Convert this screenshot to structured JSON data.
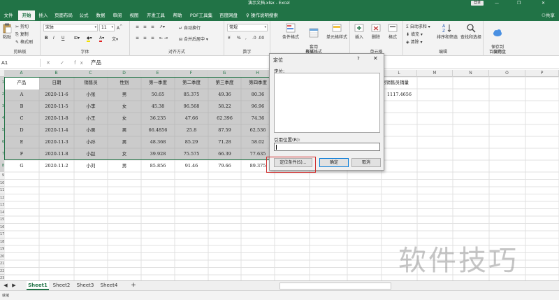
{
  "window": {
    "doc_title": "演示文档.xlsx - Excel",
    "login": "登录",
    "minimize": "—",
    "restore": "❐",
    "close": "✕"
  },
  "tabs": [
    "文件",
    "开始",
    "插入",
    "页面布局",
    "公式",
    "数据",
    "审阅",
    "视图",
    "开发工具",
    "帮助",
    "PDF工具集",
    "百度网盘"
  ],
  "active_tab": "开始",
  "tell_me": "操作说明搜索",
  "share": "共享",
  "ribbon": {
    "clipboard": {
      "label": "剪贴板",
      "paste": "粘贴",
      "cut": "剪切",
      "copy": "复制",
      "format_painter": "格式刷"
    },
    "font": {
      "label": "字体",
      "font_name": "宋体",
      "font_size": "11",
      "bold": "B",
      "italic": "I",
      "underline": "U"
    },
    "alignment": {
      "label": "对齐方式",
      "wrap": "自动换行",
      "merge": "合并后居中"
    },
    "number": {
      "label": "数字",
      "format": "常规",
      "percent": "%",
      "comma": ",",
      "currency": "¥"
    },
    "styles": {
      "label": "样式",
      "conditional": "条件格式",
      "table": "套用\n表格格式",
      "cell_styles": "单元格样式"
    },
    "cells": {
      "label": "单元格",
      "insert": "插入",
      "delete": "删除",
      "format": "格式"
    },
    "editing": {
      "label": "编辑",
      "autosum": "自动求和",
      "fill": "填充",
      "clear": "清除",
      "sort": "排序和筛选",
      "find": "查找和选择"
    },
    "save": {
      "label": "保存",
      "save_baidu": "保存到\n百度网盘"
    }
  },
  "formula_bar": {
    "name_box": "A1",
    "fx": "✕ ✓ fx",
    "content": "产品"
  },
  "columns": [
    "A",
    "B",
    "C",
    "D",
    "E",
    "F",
    "G",
    "H",
    "I",
    "J",
    "K",
    "L",
    "M",
    "N",
    "O",
    "P",
    "Q"
  ],
  "rows": [
    "1",
    "2",
    "3",
    "4",
    "5",
    "6",
    "7",
    "8",
    "9",
    "10",
    "11",
    "12",
    "13",
    "14",
    "15",
    "16",
    "17",
    "18",
    "19",
    "20",
    "21",
    "22",
    "23"
  ],
  "headers": [
    "产品",
    "日期",
    "销售员",
    "性别",
    "第一季度",
    "第二季度",
    "第三季度",
    "第四季度"
  ],
  "data_rows": [
    [
      "A",
      "2020-11-6",
      "小张",
      "男",
      "50.65",
      "85.375",
      "49.36",
      "80.36"
    ],
    [
      "B",
      "2020-11-5",
      "小李",
      "女",
      "45.38",
      "96.568",
      "58.22",
      "96.96"
    ],
    [
      "C",
      "2020-11-8",
      "小王",
      "女",
      "36.235",
      "47.66",
      "62.396",
      "74.36"
    ],
    [
      "D",
      "2020-11-4",
      "小吴",
      "男",
      "66.4856",
      "25.8",
      "87.59",
      "62.536"
    ],
    [
      "E",
      "2020-11-3",
      "小孙",
      "男",
      "48.368",
      "85.29",
      "71.28",
      "58.02"
    ],
    [
      "F",
      "2020-11-8",
      "小赵",
      "女",
      "39.928",
      "75.575",
      "66.39",
      "77.635"
    ],
    [
      "G",
      "2020-11-2",
      "小刘",
      "男",
      "85.856",
      "91.46",
      "79.66",
      "89.375"
    ]
  ],
  "extra": {
    "l1": "男销售员销量",
    "l2": "1117.4656"
  },
  "dialog": {
    "title": "定位",
    "help": "?",
    "close": "✕",
    "goto_label": "定位:",
    "ref_label": "引用位置(R):",
    "special_button": "定位条件(S)...",
    "ok_button": "确定",
    "cancel_button": "取消"
  },
  "sheets": [
    "Sheet1",
    "Sheet2",
    "Sheet3",
    "Sheet4"
  ],
  "add_sheet": "+",
  "status": "就绪",
  "watermark": "软件技巧"
}
